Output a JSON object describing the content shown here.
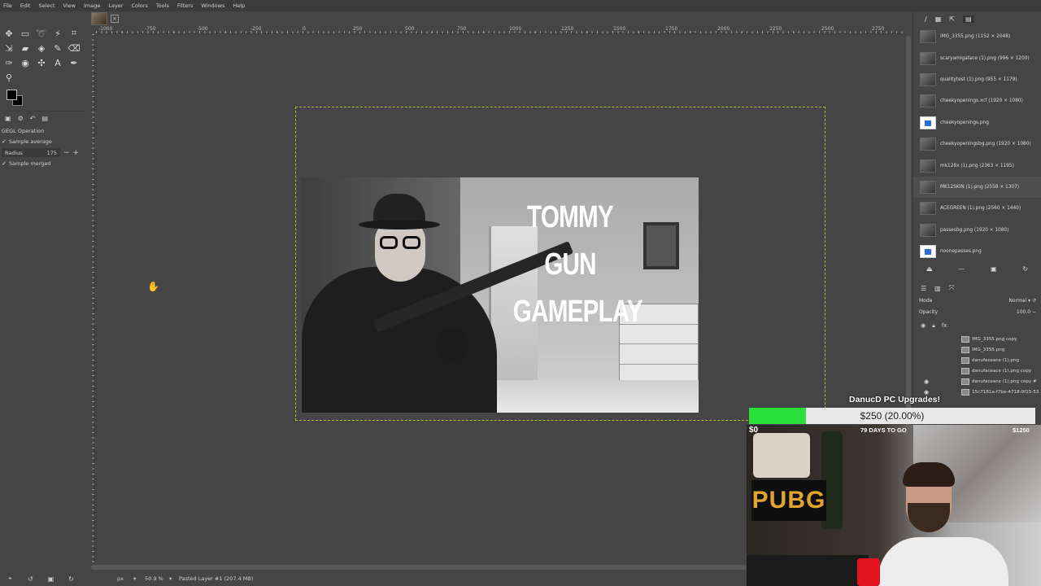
{
  "menu": [
    "File",
    "Edit",
    "Select",
    "View",
    "Image",
    "Layer",
    "Colors",
    "Tools",
    "Filters",
    "Windows",
    "Help"
  ],
  "tool_options": {
    "title": "GEGL Operation",
    "sample_average_label": "Sample average",
    "radius_label": "Radius",
    "radius_value": "175",
    "sample_merged_label": "Sample merged"
  },
  "ruler_labels": [
    "-1000",
    "-750",
    "-500",
    "-250",
    "0",
    "250",
    "500",
    "750",
    "1000",
    "1250",
    "1500",
    "1750",
    "2000",
    "2250",
    "2500",
    "2750"
  ],
  "thumbnail": {
    "line1": "TOMMY GUN",
    "line2": "GAMEPLAY"
  },
  "statusbar": {
    "unit": "px",
    "zoom": "50.9 %",
    "message": "Pasted Layer #1 (207.4 MB)"
  },
  "images_dock": {
    "items": [
      {
        "label": "IMG_3355.png (1152 × 2048)",
        "selected": false,
        "icon": "photo"
      },
      {
        "label": "scaryamigaface (1).png (996 × 1200)",
        "selected": false,
        "icon": "photo"
      },
      {
        "label": "qualitytest (1).png (955 × 1179)",
        "selected": false,
        "icon": "photo"
      },
      {
        "label": "cheekyopenings.xcf (1920 × 1080)",
        "selected": false,
        "icon": "photo"
      },
      {
        "label": "cheekyopenings.png",
        "selected": false,
        "icon": "file"
      },
      {
        "label": "cheekyopeningsbg.png (1920 × 1080)",
        "selected": false,
        "icon": "photo"
      },
      {
        "label": "mk128x (1).png (2363 × 1195)",
        "selected": false,
        "icon": "photo"
      },
      {
        "label": "MK12SKIN (1).png (2558 × 1307)",
        "selected": true,
        "icon": "photo"
      },
      {
        "label": "ACEGREEN (1).png (2560 × 1440)",
        "selected": false,
        "icon": "photo"
      },
      {
        "label": "passesbg.png (1920 × 1080)",
        "selected": false,
        "icon": "photo"
      },
      {
        "label": "noonepasses.png",
        "selected": false,
        "icon": "file"
      }
    ]
  },
  "layers_dock": {
    "mode_label": "Mode",
    "mode_value": "Normal",
    "opacity_label": "Opacity",
    "opacity_value": "100.0",
    "layers": [
      {
        "label": "IMG_3355.png copy",
        "visible": false
      },
      {
        "label": "IMG_3355.png",
        "visible": false
      },
      {
        "label": "danufaceace (1).png",
        "visible": false
      },
      {
        "label": "danufaceace (1).png copy",
        "visible": false
      },
      {
        "label": "danufaceace (1).png copy #",
        "visible": true
      },
      {
        "label": "15c7181a-f7be-4718-9f15-53",
        "visible": true
      }
    ]
  },
  "donation": {
    "goal_title": "DanucD PC Upgrades!",
    "amount_text": "$250 (20.00%)",
    "progress_fraction": 0.2,
    "min_label": "$0",
    "days_label": "79 DAYS TO GO",
    "max_label": "$1250",
    "bar_color": "#29e03a"
  },
  "webcam": {
    "poster_text": "PUBG"
  }
}
